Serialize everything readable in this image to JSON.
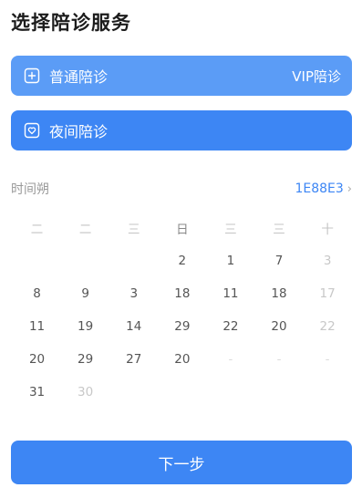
{
  "page": {
    "title": "选择陪诊服务"
  },
  "options": [
    {
      "label": "普通陪诊",
      "right_label": "VIP陪诊",
      "icon": "plus-square-icon"
    },
    {
      "label": "夜间陪诊",
      "right_label": "",
      "icon": "heart-square-icon"
    }
  ],
  "period": {
    "label": "时间朔",
    "value": "1E88E3",
    "chevron": "›"
  },
  "calendar": {
    "weekdays": [
      "二",
      "二",
      "三",
      "日",
      "三",
      "三",
      "十"
    ],
    "weeks": [
      [
        "",
        "",
        "",
        "2",
        "1",
        "7",
        "3"
      ],
      [
        "8",
        "9",
        "3",
        "18",
        "11",
        "18",
        "17"
      ],
      [
        "11",
        "19",
        "14",
        "29",
        "22",
        "20",
        "22"
      ],
      [
        "20",
        "29",
        "27",
        "20",
        "-",
        "-",
        "-"
      ],
      [
        "31",
        "30",
        "",
        "",
        "",
        "",
        ""
      ]
    ]
  },
  "footer": {
    "next_label": "下一步"
  },
  "colors": {
    "primary": "#3d86f4",
    "option_light": "#5b9cf6",
    "muted": "#999999"
  }
}
